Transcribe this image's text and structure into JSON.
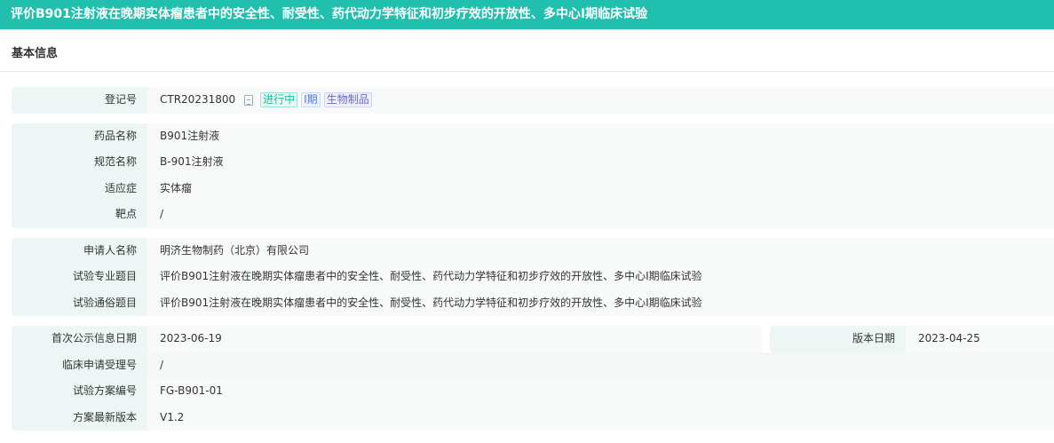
{
  "title": "评价B901注射液在晚期实体瘤患者中的安全性、耐受性、药代动力学特征和初步疗效的开放性、多中心Ⅰ期临床试验",
  "section": "基本信息",
  "reg": {
    "label": "登记号",
    "value": "CTR20231800",
    "tags": [
      "进行中",
      "I期",
      "生物制品"
    ]
  },
  "drug": [
    {
      "label": "药品名称",
      "value": "B901注射液"
    },
    {
      "label": "规范名称",
      "value": "B-901注射液"
    },
    {
      "label": "适应症",
      "value": "实体瘤"
    },
    {
      "label": "靶点",
      "value": "/"
    }
  ],
  "applicant": [
    {
      "label": "申请人名称",
      "value": "明济生物制药（北京）有限公司"
    },
    {
      "label": "试验专业题目",
      "value": "评价B901注射液在晚期实体瘤患者中的安全性、耐受性、药代动力学特征和初步疗效的开放性、多中心Ⅰ期临床试验"
    },
    {
      "label": "试验通俗题目",
      "value": "评价B901注射液在晚期实体瘤患者中的安全性、耐受性、药代动力学特征和初步疗效的开放性、多中心Ⅰ期临床试验"
    }
  ],
  "info": [
    {
      "label": "首次公示信息日期",
      "value": "2023-06-19"
    },
    {
      "label": "版本日期",
      "value": "2023-04-25"
    },
    {
      "label": "临床申请受理号",
      "value": "/"
    },
    {
      "label": "试验方案编号",
      "value": "FG-B901-01"
    },
    {
      "label": "方案最新版本",
      "value": "V1.2"
    }
  ]
}
